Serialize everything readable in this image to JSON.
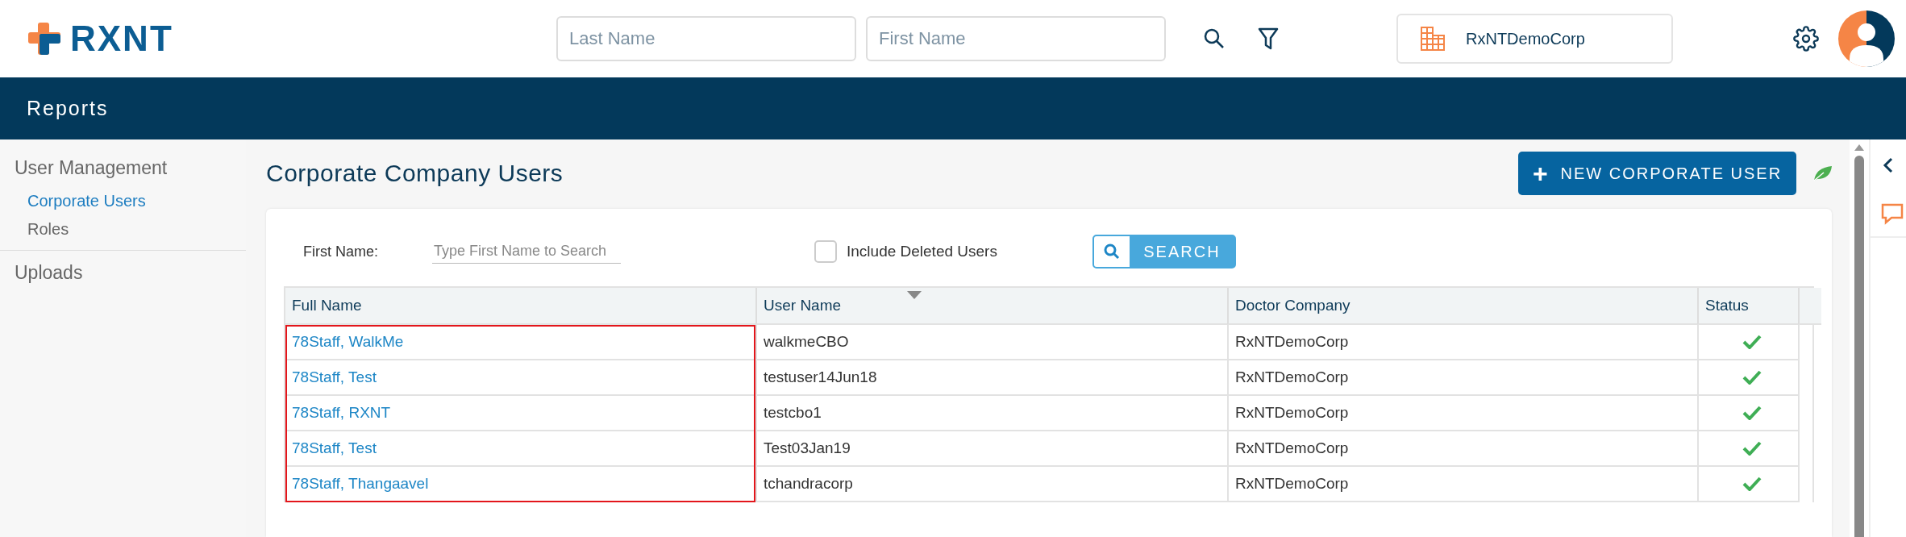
{
  "header": {
    "logo": "RXNT",
    "last_name_field": {
      "placeholder": "Last Name"
    },
    "first_name_field": {
      "placeholder": "First Name"
    },
    "company": "RxNTDemoCorp"
  },
  "navbar": {
    "title": "Reports"
  },
  "sidebar": {
    "sections": [
      {
        "label": "User Management",
        "children": [
          {
            "label": "Corporate Users",
            "selected": true
          },
          {
            "label": "Roles",
            "selected": false
          }
        ]
      },
      {
        "label": "Uploads"
      }
    ]
  },
  "page": {
    "title": "Corporate Company Users",
    "new_button": {
      "icon": "+",
      "label": "NEW CORPORATE USER"
    }
  },
  "filters": {
    "first_name_label": "First Name:",
    "first_name_field": {
      "placeholder": "Type First Name to Search"
    },
    "include_deleted": {
      "label": "Include Deleted Users",
      "checked": false
    },
    "search_button": "SEARCH"
  },
  "table": {
    "columns": [
      {
        "label": "Full Name",
        "sorted": false,
        "highlighted": true
      },
      {
        "label": "User Name",
        "sorted": true,
        "highlighted": false
      },
      {
        "label": "Doctor Company",
        "sorted": false,
        "highlighted": false
      },
      {
        "label": "Status",
        "sorted": false,
        "highlighted": false
      }
    ],
    "rows": [
      {
        "full_name": "78Staff, WalkMe",
        "user_name": "walkmeCBO",
        "doctor_company": "RxNTDemoCorp",
        "active": true
      },
      {
        "full_name": "78Staff, Test",
        "user_name": "testuser14Jun18",
        "doctor_company": "RxNTDemoCorp",
        "active": true
      },
      {
        "full_name": "78Staff, RXNT",
        "user_name": "testcbo1",
        "doctor_company": "RxNTDemoCorp",
        "active": true
      },
      {
        "full_name": "78Staff, Test",
        "user_name": "Test03Jan19",
        "doctor_company": "RxNTDemoCorp",
        "active": true
      },
      {
        "full_name": "78Staff, Thangaavel",
        "user_name": "tchandracorp",
        "doctor_company": "RxNTDemoCorp",
        "active": true
      }
    ]
  }
}
